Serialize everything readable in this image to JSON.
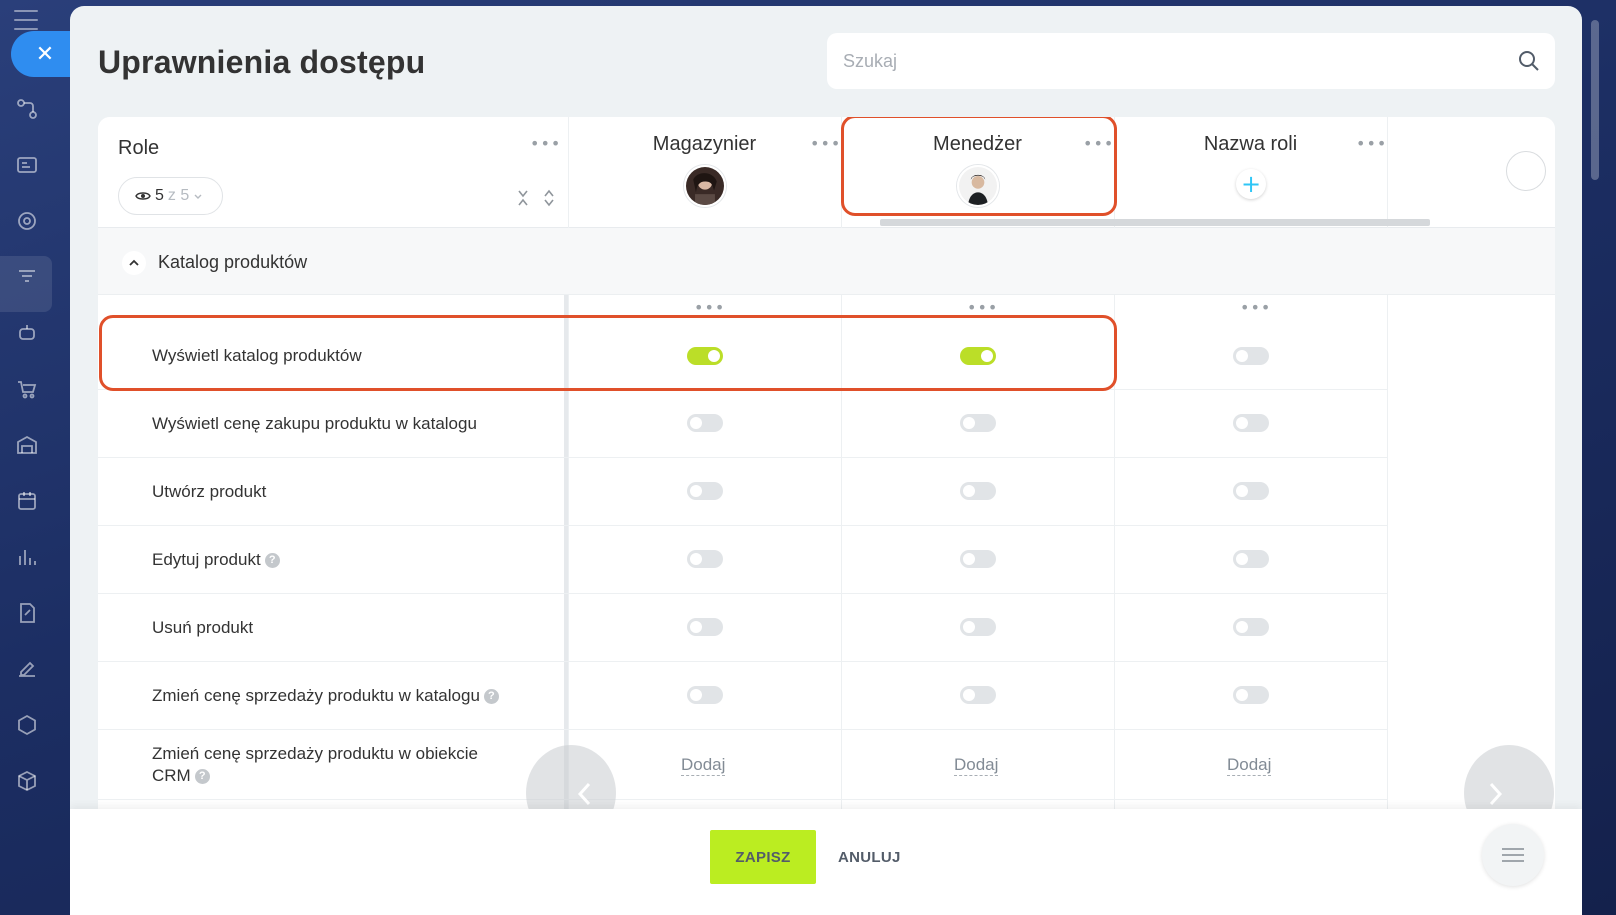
{
  "page": {
    "title": "Uprawnienia dostępu"
  },
  "search": {
    "placeholder": "Szukaj"
  },
  "roles_header": {
    "title": "Role",
    "visible_count": "5",
    "total_label": "z 5"
  },
  "roles": [
    {
      "name": "Magazynier"
    },
    {
      "name": "Menedżer"
    },
    {
      "name": "Nazwa roli"
    }
  ],
  "section": {
    "title": "Katalog produktów"
  },
  "permissions": [
    {
      "label": "Wyświetl katalog produktów",
      "help": false,
      "values": [
        "on",
        "on",
        "off"
      ]
    },
    {
      "label": "Wyświetl cenę zakupu produktu w katalogu",
      "help": false,
      "values": [
        "off",
        "off",
        "off"
      ]
    },
    {
      "label": "Utwórz produkt",
      "help": false,
      "values": [
        "off",
        "off",
        "off"
      ]
    },
    {
      "label": "Edytuj produkt",
      "help": true,
      "values": [
        "off",
        "off",
        "off"
      ]
    },
    {
      "label": "Usuń produkt",
      "help": false,
      "values": [
        "off",
        "off",
        "off"
      ]
    },
    {
      "label": "Zmień cenę sprzedaży produktu w katalogu",
      "help": true,
      "values": [
        "off",
        "off",
        "off"
      ]
    },
    {
      "label": "Zmień cenę sprzedaży produktu w obiekcie CRM",
      "help": true,
      "values": [
        "Dodaj",
        "Dodaj",
        "Dodaj"
      ]
    }
  ],
  "help_glyph": "?",
  "footer": {
    "save_label": "ZAPISZ",
    "cancel_label": "ANULUJ"
  },
  "colors": {
    "toggle_on": "#bbde28",
    "accent_blue": "#2f8df0",
    "highlight": "#e0502a",
    "save": "#bbed21"
  },
  "icons": {
    "close": "close-icon",
    "search": "search-icon",
    "eye": "eye-icon",
    "add": "plus-icon"
  }
}
